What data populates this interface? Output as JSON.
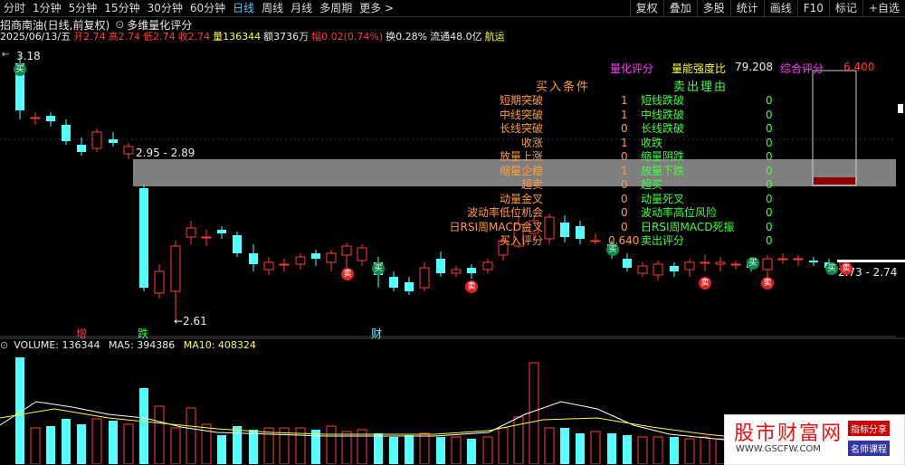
{
  "toolbar": {
    "tabs": [
      "分时",
      "1分钟",
      "5分钟",
      "15分钟",
      "30分钟",
      "60分钟",
      "日线",
      "周线",
      "月线",
      "多周期",
      "更多 >"
    ],
    "active_tab": "日线",
    "right_tools": [
      "复权",
      "叠加",
      "多股",
      "统计",
      "画线",
      "F10",
      "标记",
      "+自选"
    ]
  },
  "header": {
    "stock_title": "招商南油(日线,前复权)",
    "indicator_name": "多维量化评分",
    "date": "2025/06/13/五",
    "open_label": "开",
    "open": "2.74",
    "high_label": "高",
    "high": "2.74",
    "low_label": "低",
    "low": "2.74",
    "close_label": "收",
    "close": "2.74",
    "vol_label": "量",
    "vol": "136344",
    "amount_label": "额",
    "amount": "3736万",
    "pct_label": "幅",
    "pct": "0.02(0.74%)",
    "turnover": "换0.28%",
    "float_cap": "流通48.0亿",
    "sector": "航运"
  },
  "price_labels": {
    "high_mark": "3.18",
    "range_mark": "2.95 - 2.89",
    "low_mark": "←2.61",
    "right_range": "2.73 - 2.74",
    "score_mark": "0.640"
  },
  "events": {
    "e1": "增",
    "e2": "跌",
    "e3": "财"
  },
  "panel": {
    "quant_score_label": "量化评分",
    "vol_strength_label": "量能强度比",
    "vol_strength_value": "79.208",
    "composite_label": "综合评分",
    "composite_value": "6.400",
    "buy_header": "买入条件",
    "sell_header": "卖出理由",
    "buy_rows": [
      {
        "name": "短期突破",
        "v": "1"
      },
      {
        "name": "中线突破",
        "v": "1"
      },
      {
        "name": "长线突破",
        "v": "0"
      },
      {
        "name": "收涨",
        "v": "1"
      },
      {
        "name": "放量上涨",
        "v": "0"
      },
      {
        "name": "缩量企稳",
        "v": "1"
      },
      {
        "name": "超卖",
        "v": "0"
      },
      {
        "name": "动量金叉",
        "v": "0"
      },
      {
        "name": "波动率低位机会",
        "v": "0"
      },
      {
        "name": "日RSI周MACD金叉",
        "v": "0"
      },
      {
        "name": "买入评分",
        "v": "0.640"
      }
    ],
    "sell_rows": [
      {
        "name": "短线跌破",
        "v": "0"
      },
      {
        "name": "中线跌破",
        "v": "0"
      },
      {
        "name": "长线跌破",
        "v": "0"
      },
      {
        "name": "收跌",
        "v": "0"
      },
      {
        "name": "缩量阴跌",
        "v": "0"
      },
      {
        "name": "放量下跌",
        "v": "0"
      },
      {
        "name": "超买",
        "v": "0"
      },
      {
        "name": "动量死叉",
        "v": "0"
      },
      {
        "name": "波动率高位风险",
        "v": "0"
      },
      {
        "name": "日RSI周MACD死振",
        "v": "0"
      },
      {
        "name": "卖出评分",
        "v": "0"
      }
    ]
  },
  "markers": {
    "buy": "买",
    "sell": "卖"
  },
  "volume": {
    "title": "VOLUME: 136344",
    "ma5": "MA5: 394386",
    "ma10": "MA10: 408324"
  },
  "watermark": {
    "title": "股市财富网",
    "url": "WWW.GSCFW.COM",
    "badge1": "指标分享",
    "badge2": "名师课程"
  }
}
